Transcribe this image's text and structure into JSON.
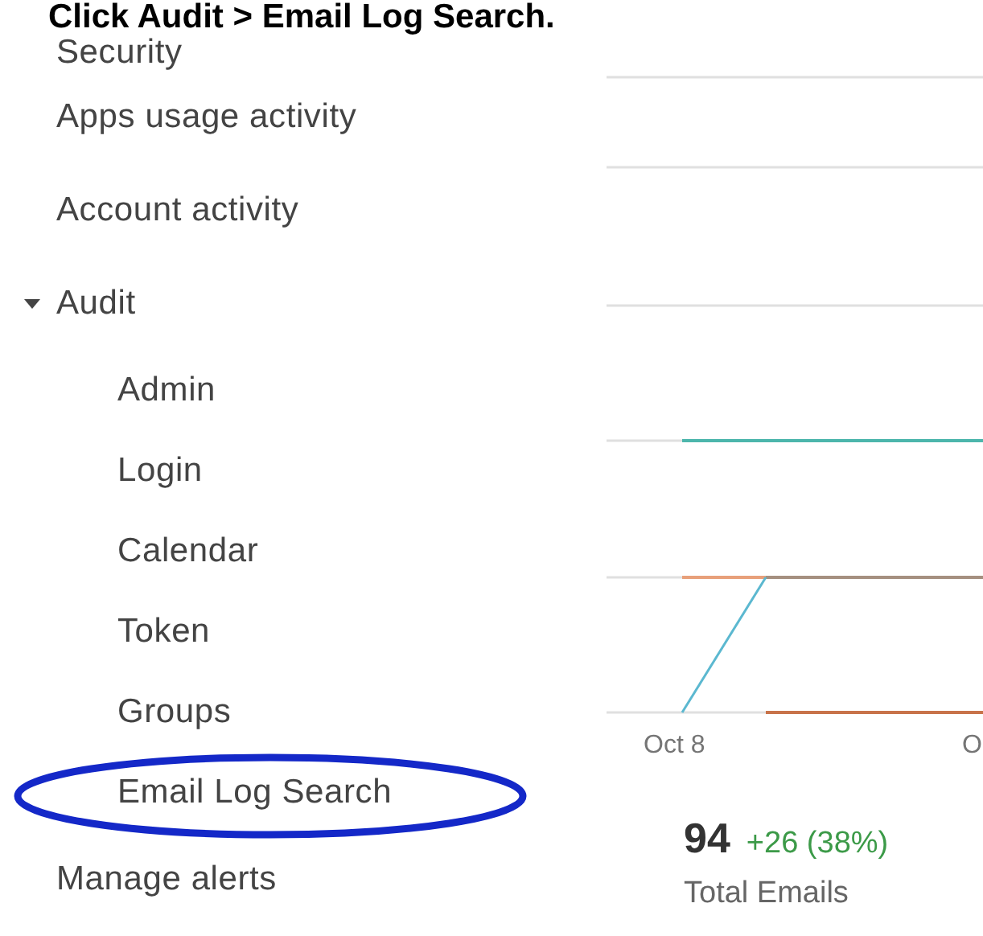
{
  "instruction": "Click Audit > Email Log Search.",
  "sidebar": {
    "items": [
      {
        "label": "Security"
      },
      {
        "label": "Apps usage activity"
      },
      {
        "label": "Account activity"
      },
      {
        "label": "Audit",
        "expanded": true,
        "children": [
          {
            "label": "Admin"
          },
          {
            "label": "Login"
          },
          {
            "label": "Calendar"
          },
          {
            "label": "Token"
          },
          {
            "label": "Groups"
          },
          {
            "label": "Email Log Search"
          }
        ]
      },
      {
        "label": "Manage alerts"
      }
    ]
  },
  "chart": {
    "x_labels": [
      "Oct 8",
      "O"
    ]
  },
  "summary": {
    "value": "94",
    "change": "+26 (38%)",
    "label": "Total Emails"
  }
}
